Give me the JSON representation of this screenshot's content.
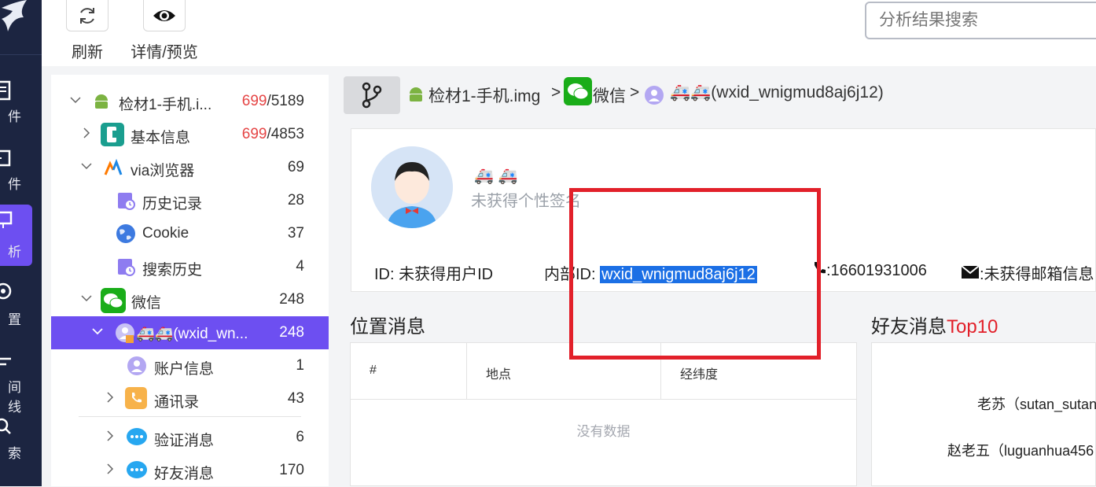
{
  "toolbar": {
    "refresh_label": "刷新",
    "detail_label": "详情/预览"
  },
  "search": {
    "placeholder": "分析结果搜索"
  },
  "leftnav": {
    "items": [
      "件",
      "件",
      "析",
      "置",
      "间线",
      "索"
    ]
  },
  "tree": {
    "root": {
      "label": "检材1-手机.i...",
      "count_red": "699",
      "count_rest": "/5189"
    },
    "basic": {
      "label": "基本信息",
      "count_red": "699",
      "count_rest": "/4853"
    },
    "via": {
      "label": "via浏览器",
      "count": "69"
    },
    "history": {
      "label": "历史记录",
      "count": "28"
    },
    "cookie": {
      "label": "Cookie",
      "count": "37"
    },
    "search_history": {
      "label": "搜索历史",
      "count": "4"
    },
    "wechat": {
      "label": "微信",
      "count": "248"
    },
    "account": {
      "label": "🚑🚑(wxid_wn...",
      "count": "248"
    },
    "account_info": {
      "label": "账户信息",
      "count": "1"
    },
    "contacts": {
      "label": "通讯录",
      "count": "43"
    },
    "verify": {
      "label": "验证消息",
      "count": "6"
    },
    "friend_msg": {
      "label": "好友消息",
      "count": "170"
    }
  },
  "breadcrumb": {
    "image": "检材1-手机.img",
    "app": "微信",
    "account": "🚑🚑(wxid_wnigmud8aj6j12)",
    "sep": ">"
  },
  "profile": {
    "nickname": "🚑 🚑",
    "signature": "未获得个性签名",
    "id_text": "ID: 未获得用户ID",
    "internal_label": "内部ID: ",
    "internal_id": "wxid_wnigmud8aj6j12",
    "phone": ":16601931006",
    "email": ":未获得邮箱信息"
  },
  "location": {
    "title": "位置消息",
    "columns": [
      "#",
      "地点",
      "经纬度"
    ],
    "empty": "没有数据"
  },
  "friends": {
    "title_prefix": "好友消息",
    "title_suffix": "Top10",
    "items": [
      "老苏（sutan_sutan",
      "赵老五（luguanhua456"
    ]
  },
  "colors": {
    "accent": "#6d4ff1",
    "nav_bg": "#1c2541",
    "highlight": "#1b6fe5",
    "annotation": "#e2202a",
    "count_red": "#e54545"
  }
}
